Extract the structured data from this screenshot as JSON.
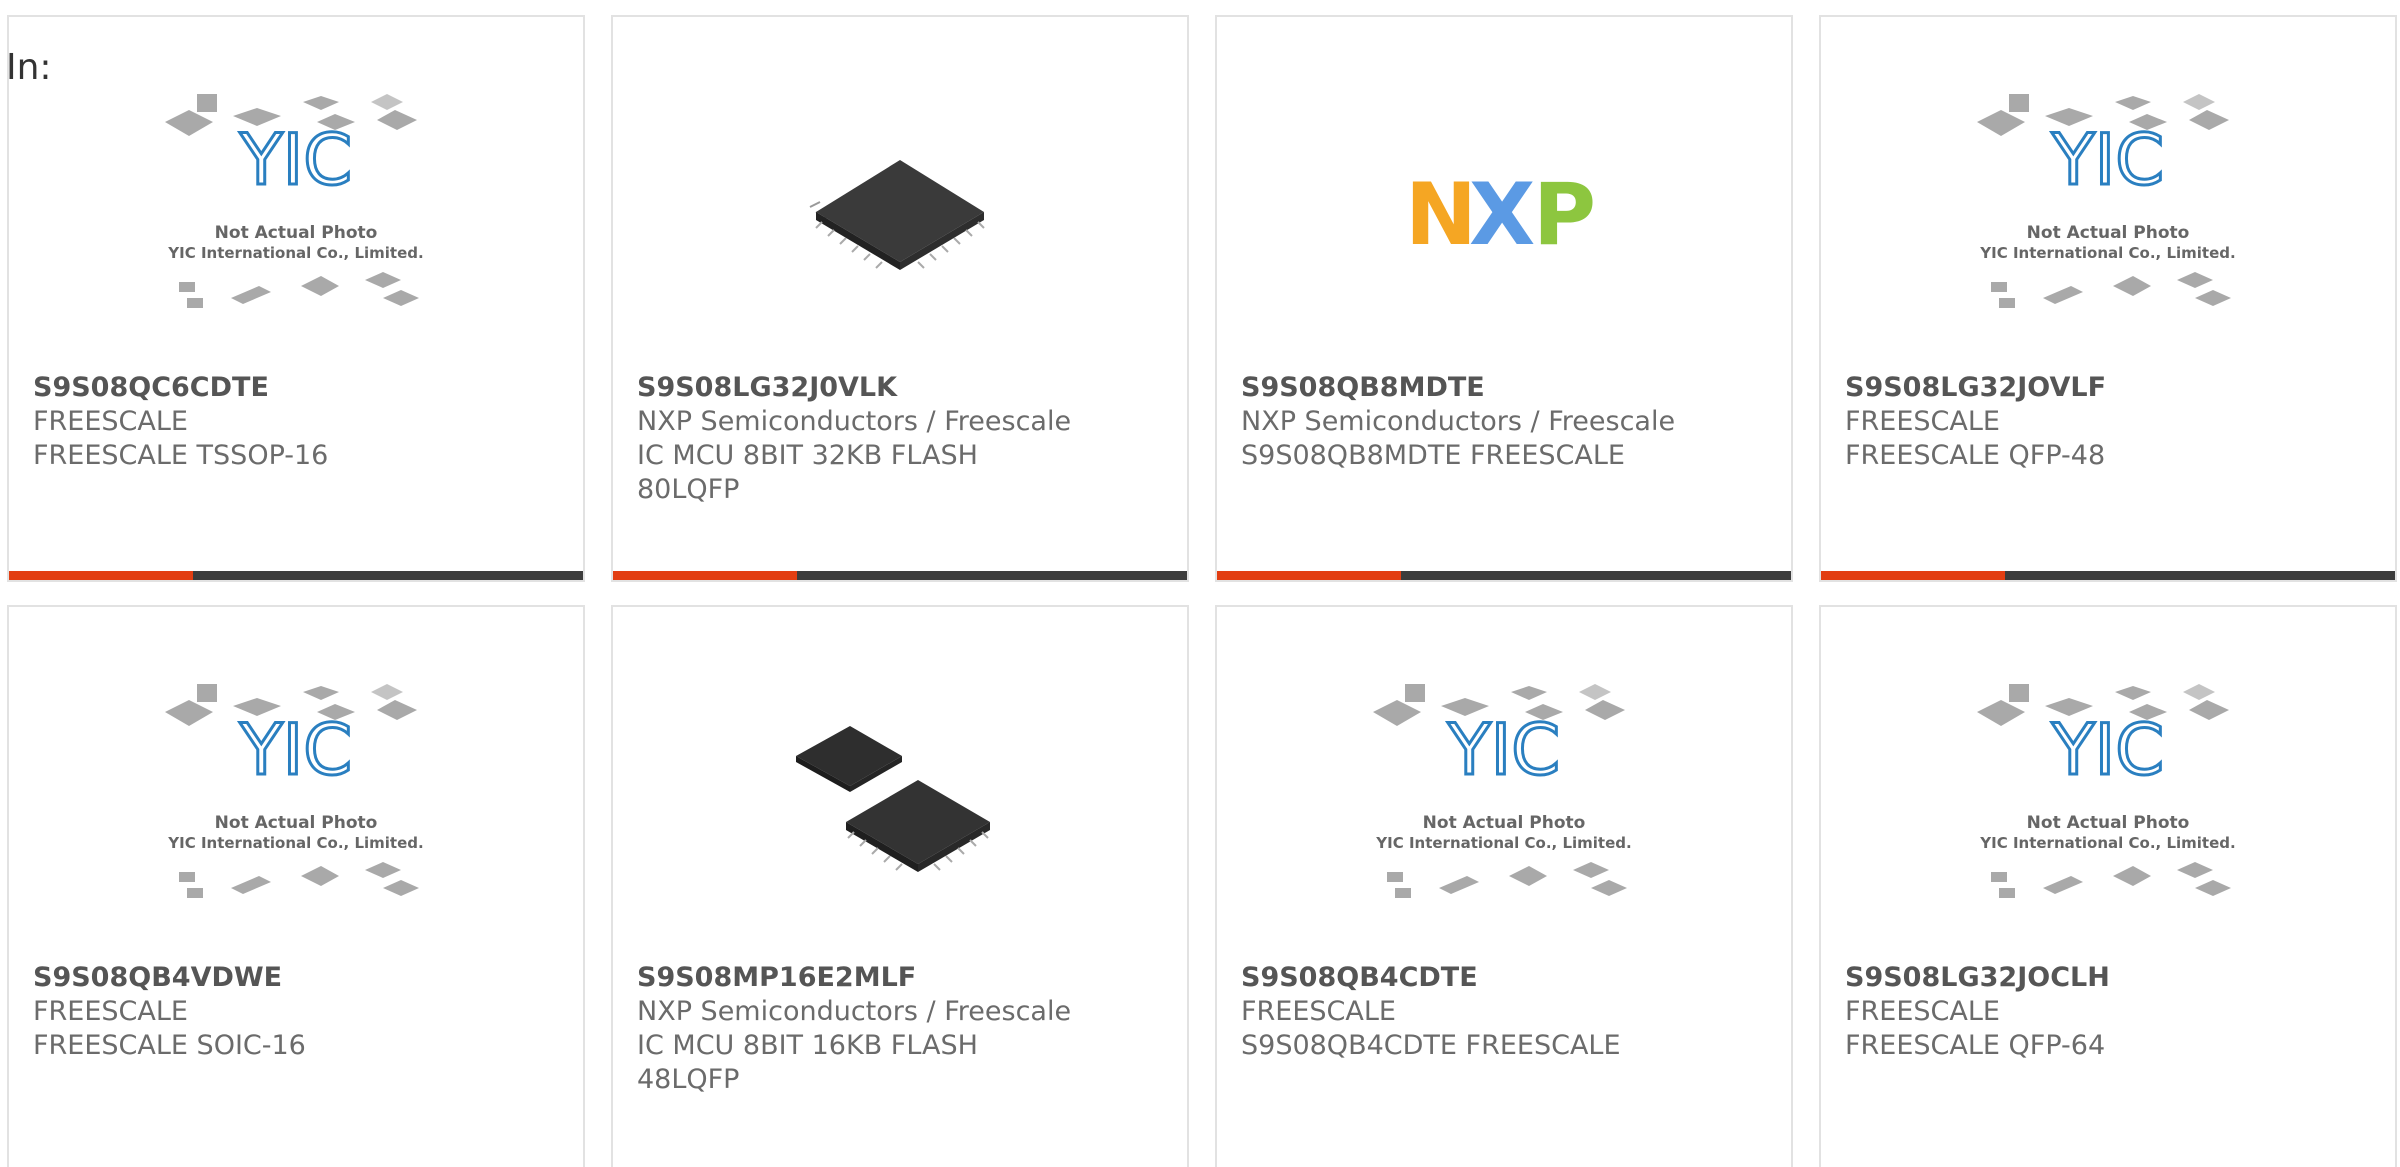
{
  "filter": {
    "label": "In:"
  },
  "brand_colors": {
    "accent": "#e23e12",
    "dark": "#3c3c3c",
    "placeholder_blue": "#2a7fc0"
  },
  "products": [
    {
      "part": "S9S08QC6CDTE",
      "maker": "FREESCALE",
      "desc": [
        "FREESCALE TSSOP-16"
      ],
      "image": "yic-placeholder"
    },
    {
      "part": "S9S08LG32J0VLK",
      "maker": "NXP Semiconductors / Freescale",
      "desc": [
        "IC MCU 8BIT 32KB FLASH",
        "80LQFP"
      ],
      "image": "qfp-chip"
    },
    {
      "part": "S9S08QB8MDTE",
      "maker": "NXP Semiconductors / Freescale",
      "desc": [
        "S9S08QB8MDTE FREESCALE"
      ],
      "image": "nxp-logo"
    },
    {
      "part": "S9S08LG32JOVLF",
      "maker": "FREESCALE",
      "desc": [
        "FREESCALE QFP-48"
      ],
      "image": "yic-placeholder"
    },
    {
      "part": "S9S08QB4VDWE",
      "maker": "FREESCALE",
      "desc": [
        "FREESCALE SOIC-16"
      ],
      "image": "yic-placeholder"
    },
    {
      "part": "S9S08MP16E2MLF",
      "maker": "NXP Semiconductors / Freescale",
      "desc": [
        "IC MCU 8BIT 16KB FLASH",
        "48LQFP"
      ],
      "image": "two-chips"
    },
    {
      "part": "S9S08QB4CDTE",
      "maker": "FREESCALE",
      "desc": [
        "S9S08QB4CDTE FREESCALE"
      ],
      "image": "yic-placeholder"
    },
    {
      "part": "S9S08LG32JOCLH",
      "maker": "FREESCALE",
      "desc": [
        "FREESCALE QFP-64"
      ],
      "image": "yic-placeholder"
    }
  ],
  "placeholder": {
    "line1": "Not Actual Photo",
    "line2": "YIC International Co., Limited.",
    "logo_text": "YIC"
  },
  "nxp_logo": {
    "letters": [
      "N",
      "X",
      "P"
    ],
    "colors": [
      "#f5a623",
      "#4a90e2",
      "#8dc63f"
    ]
  }
}
